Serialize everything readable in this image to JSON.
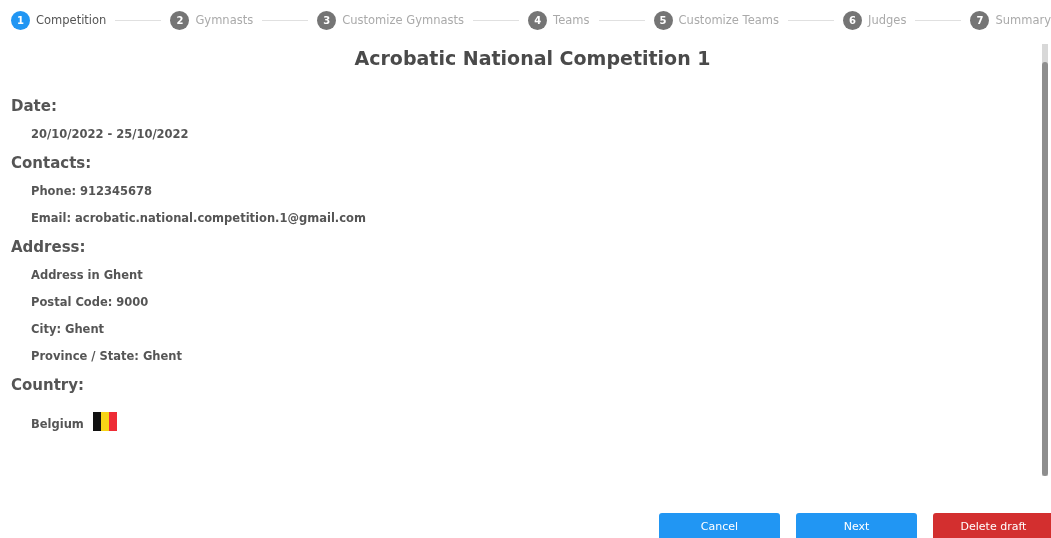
{
  "steps": [
    {
      "number": "1",
      "label": "Competition",
      "selected": true
    },
    {
      "number": "2",
      "label": "Gymnasts",
      "selected": false
    },
    {
      "number": "3",
      "label": "Customize Gymnasts",
      "selected": false
    },
    {
      "number": "4",
      "label": "Teams",
      "selected": false
    },
    {
      "number": "5",
      "label": "Customize Teams",
      "selected": false
    },
    {
      "number": "6",
      "label": "Judges",
      "selected": false
    },
    {
      "number": "7",
      "label": "Summary",
      "selected": false
    }
  ],
  "title": "Acrobatic National Competition 1",
  "sections": [
    {
      "heading": "Date:",
      "lines": [
        "20/10/2022 - 25/10/2022"
      ]
    },
    {
      "heading": "Contacts:",
      "lines": [
        "Phone: 912345678",
        "Email: acrobatic.national.competition.1@gmail.com"
      ]
    },
    {
      "heading": "Address:",
      "lines": [
        "Address in Ghent",
        "Postal Code: 9000",
        "City: Ghent",
        "Province / State: Ghent"
      ]
    }
  ],
  "country": {
    "heading": "Country:",
    "name": "Belgium"
  },
  "buttons": [
    {
      "label": "Cancel",
      "kind": "primary"
    },
    {
      "label": "Next",
      "kind": "primary"
    },
    {
      "label": "Delete draft",
      "kind": "danger"
    }
  ]
}
